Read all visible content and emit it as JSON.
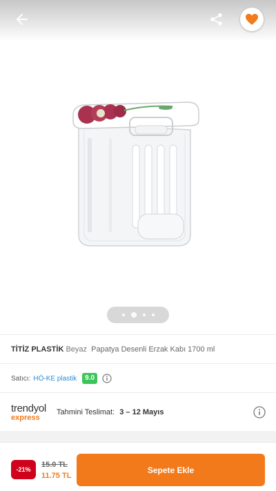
{
  "colors": {
    "accent": "#f27a1a",
    "discount": "#d0021b",
    "rating": "#3cc45a",
    "seller_link": "#2a8bd6"
  },
  "header": {
    "back_icon": "arrow-left-icon",
    "share_icon": "share-icon",
    "favorite_icon": "heart-icon"
  },
  "gallery": {
    "image_count": 4,
    "active_index": 1
  },
  "product": {
    "brand": "TİTİZ PLASTİK",
    "color": "Beyaz",
    "name": "Papatya Desenli Erzak Kabı 1700 ml"
  },
  "seller": {
    "label": "Satıcı:",
    "name": "HÖ-KE plastik",
    "rating": "9.0",
    "info_icon": "info-icon"
  },
  "delivery": {
    "logo_top": "trendyol",
    "logo_bottom": "express",
    "label": "Tahmini Teslimat:",
    "dates": "3 – 12 Mayıs",
    "info_icon": "info-icon"
  },
  "price": {
    "discount": "-21%",
    "old": "15.0 TL",
    "new": "11.75 TL"
  },
  "actions": {
    "add_to_cart": "Sepete Ekle"
  }
}
